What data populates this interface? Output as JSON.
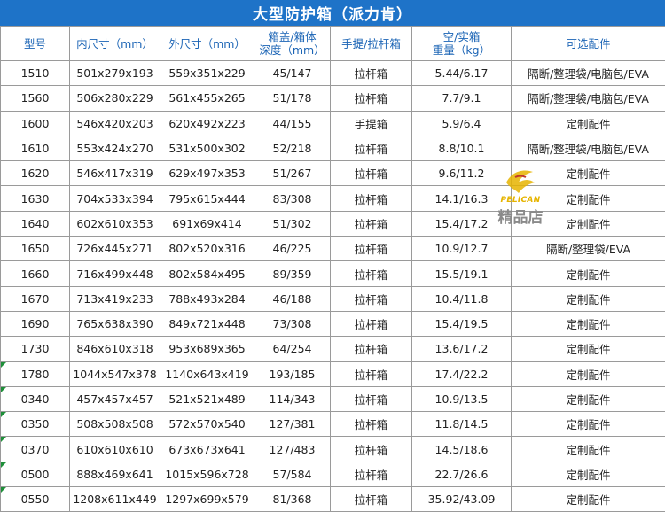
{
  "title": "大型防护箱（派力肯）",
  "header": {
    "model": "型号",
    "inner": "内尺寸（mm）",
    "outer": "外尺寸（mm）",
    "depth_line1": "箱盖/箱体",
    "depth_line2": "深度（mm）",
    "handle": "手提/拉杆箱",
    "weight_line1": "空/实箱",
    "weight_line2": "重量（kg）",
    "accessories": "可选配件"
  },
  "rows": [
    {
      "model": "1510",
      "inner": "501x279x193",
      "outer": "559x351x229",
      "depth": "45/147",
      "handle": "拉杆箱",
      "weight": "5.44/6.17",
      "accessories": "隔断/整理袋/电脑包/EVA"
    },
    {
      "model": "1560",
      "inner": "506x280x229",
      "outer": "561x455x265",
      "depth": "51/178",
      "handle": "拉杆箱",
      "weight": "7.7/9.1",
      "accessories": "隔断/整理袋/电脑包/EVA"
    },
    {
      "model": "1600",
      "inner": "546x420x203",
      "outer": "620x492x223",
      "depth": "44/155",
      "handle": "手提箱",
      "weight": "5.9/6.4",
      "accessories": "定制配件"
    },
    {
      "model": "1610",
      "inner": "553x424x270",
      "outer": "531x500x302",
      "depth": "52/218",
      "handle": "拉杆箱",
      "weight": "8.8/10.1",
      "accessories": "隔断/整理袋/电脑包/EVA"
    },
    {
      "model": "1620",
      "inner": "546x417x319",
      "outer": "629x497x353",
      "depth": "51/267",
      "handle": "拉杆箱",
      "weight": "9.6/11.2",
      "accessories": "定制配件"
    },
    {
      "model": "1630",
      "inner": "704x533x394",
      "outer": "795x615x444",
      "depth": "83/308",
      "handle": "拉杆箱",
      "weight": "14.1/16.3",
      "accessories": "定制配件"
    },
    {
      "model": "1640",
      "inner": "602x610x353",
      "outer": "691x69x414",
      "depth": "51/302",
      "handle": "拉杆箱",
      "weight": "15.4/17.2",
      "accessories": "定制配件"
    },
    {
      "model": "1650",
      "inner": "726x445x271",
      "outer": "802x520x316",
      "depth": "46/225",
      "handle": "拉杆箱",
      "weight": "10.9/12.7",
      "accessories": "隔断/整理袋/EVA"
    },
    {
      "model": "1660",
      "inner": "716x499x448",
      "outer": "802x584x495",
      "depth": "89/359",
      "handle": "拉杆箱",
      "weight": "15.5/19.1",
      "accessories": "定制配件"
    },
    {
      "model": "1670",
      "inner": "713x419x233",
      "outer": "788x493x284",
      "depth": "46/188",
      "handle": "拉杆箱",
      "weight": "10.4/11.8",
      "accessories": "定制配件"
    },
    {
      "model": "1690",
      "inner": "765x638x390",
      "outer": "849x721x448",
      "depth": "73/308",
      "handle": "拉杆箱",
      "weight": "15.4/19.5",
      "accessories": "定制配件"
    },
    {
      "model": "1730",
      "inner": "846x610x318",
      "outer": "953x689x365",
      "depth": "64/254",
      "handle": "拉杆箱",
      "weight": "13.6/17.2",
      "accessories": "定制配件"
    },
    {
      "model": "1780",
      "inner": "1044x547x378",
      "outer": "1140x643x419",
      "depth": "193/185",
      "handle": "拉杆箱",
      "weight": "17.4/22.2",
      "accessories": "定制配件"
    },
    {
      "model": "0340",
      "inner": "457x457x457",
      "outer": "521x521x489",
      "depth": "114/343",
      "handle": "拉杆箱",
      "weight": "10.9/13.5",
      "accessories": "定制配件"
    },
    {
      "model": "0350",
      "inner": "508x508x508",
      "outer": "572x570x540",
      "depth": "127/381",
      "handle": "拉杆箱",
      "weight": "11.8/14.5",
      "accessories": "定制配件"
    },
    {
      "model": "0370",
      "inner": "610x610x610",
      "outer": "673x673x641",
      "depth": "127/483",
      "handle": "拉杆箱",
      "weight": "14.5/18.6",
      "accessories": "定制配件"
    },
    {
      "model": "0500",
      "inner": "888x469x641",
      "outer": "1015x596x728",
      "depth": "57/584",
      "handle": "拉杆箱",
      "weight": "22.7/26.6",
      "accessories": "定制配件"
    },
    {
      "model": "0550",
      "inner": "1208x611x449",
      "outer": "1297x699x579",
      "depth": "81/368",
      "handle": "拉杆箱",
      "weight": "35.92/43.09",
      "accessories": "定制配件"
    }
  ],
  "logo": {
    "brand": "PELICAN",
    "shop": "精品店"
  },
  "colors": {
    "title_bg": "#1e73c8",
    "header_text": "#1b64b5",
    "grid": "#9a9a9a",
    "logo_gold": "#e6b400"
  }
}
